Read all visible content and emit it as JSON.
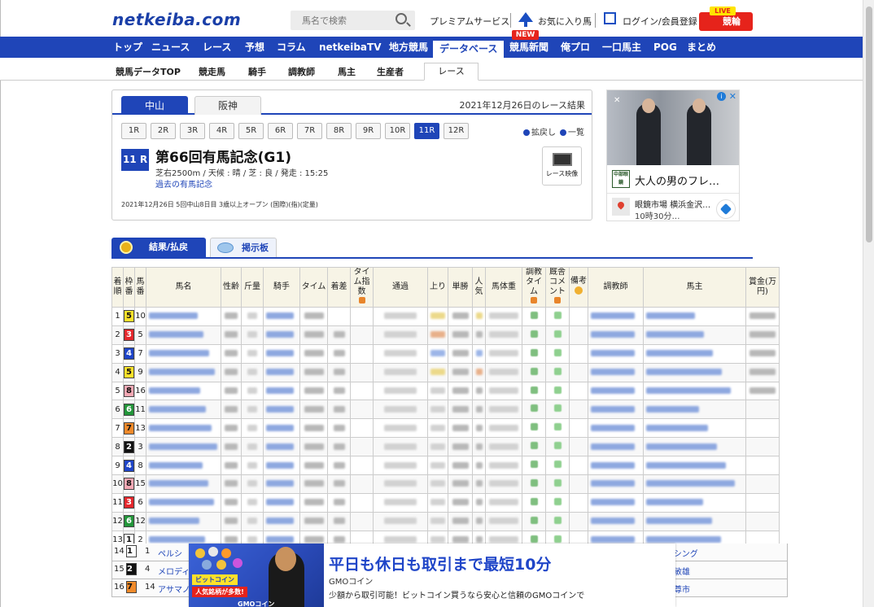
{
  "header": {
    "logo": "netkeiba.com",
    "search_placeholder": "馬名で検索",
    "premium": "プレミアムサービス",
    "favorites": "お気に入り馬",
    "login": "ログイン/会員登録",
    "live_tag": "LIVE",
    "live_label": "競輪"
  },
  "main_nav": {
    "new_tag": "NEW",
    "items": [
      "トップ",
      "ニュース",
      "レース",
      "予想",
      "コラム",
      "netkeibaTV",
      "地方競馬",
      "データベース",
      "競馬新聞",
      "俺プロ",
      "一口馬主",
      "POG",
      "まとめ"
    ]
  },
  "sub_nav": {
    "items": [
      "競馬データTOP",
      "競走馬",
      "騎手",
      "調教師",
      "馬主",
      "生産者",
      "レース"
    ]
  },
  "race": {
    "venues": [
      "中山",
      "阪神"
    ],
    "result_date": "2021年12月26日のレース結果",
    "rounds": [
      "1R",
      "2R",
      "3R",
      "4R",
      "5R",
      "6R",
      "7R",
      "8R",
      "9R",
      "10R",
      "11R",
      "12R"
    ],
    "expand": "拡戻し",
    "list": "一覧",
    "race_no": "11 R",
    "name": "第66回有馬記念(G1)",
    "detail": "芝右2500m / 天候 : 晴 / 芝 : 良 / 発走 : 15:25",
    "past": "過去の有馬記念",
    "sub": "2021年12月26日 5回中山8日目 3歳以上オープン (国際)(指)(定量)",
    "video": "レース映像"
  },
  "side_ad": {
    "logo": "中部眼鏡",
    "title": "大人の男のフレ…",
    "place": "眼鏡市場 横浜金沢…",
    "hours": "10時30分…"
  },
  "result_tabs": {
    "result": "結果/払戻",
    "board": "掲示板"
  },
  "table": {
    "headers": [
      "着順",
      "枠番",
      "馬番",
      "馬名",
      "性齢",
      "斤量",
      "騎手",
      "タイム",
      "着差",
      "タイム指数",
      "通過",
      "上り",
      "単勝",
      "人気",
      "馬体重",
      "調教タイム",
      "厩舎コメント",
      "備考",
      "調教師",
      "馬主",
      "賞金(万円)"
    ],
    "rows": [
      {
        "rank": "1",
        "frame": "5",
        "num": "10"
      },
      {
        "rank": "2",
        "frame": "3",
        "num": "5"
      },
      {
        "rank": "3",
        "frame": "4",
        "num": "7"
      },
      {
        "rank": "4",
        "frame": "5",
        "num": "9"
      },
      {
        "rank": "5",
        "frame": "8",
        "num": "16"
      },
      {
        "rank": "6",
        "frame": "6",
        "num": "11"
      },
      {
        "rank": "7",
        "frame": "7",
        "num": "13"
      },
      {
        "rank": "8",
        "frame": "2",
        "num": "3"
      },
      {
        "rank": "9",
        "frame": "4",
        "num": "8"
      },
      {
        "rank": "10",
        "frame": "8",
        "num": "15"
      },
      {
        "rank": "11",
        "frame": "3",
        "num": "6"
      },
      {
        "rank": "12",
        "frame": "6",
        "num": "12"
      },
      {
        "rank": "13",
        "frame": "1",
        "num": "2"
      }
    ],
    "lower_rows": [
      {
        "rank": "14",
        "frame": "1",
        "num": "1",
        "name": "ペルシ",
        "owner": "ーシング"
      },
      {
        "rank": "15",
        "frame": "2",
        "num": "4",
        "name": "メロディー",
        "owner": "敏雄"
      },
      {
        "rank": "16",
        "frame": "7",
        "num": "14",
        "name": "アサマノ",
        "owner": "尊市"
      }
    ]
  },
  "bottom_ad": {
    "tag1": "ビットコイン",
    "tag2": "人気銘柄が多数!",
    "logo": "GMOコイン",
    "headline": "平日も休日も取引まで最短10分",
    "brand": "GMOコイン",
    "desc": "少額から取引可能！ビットコイン買うなら安心と信頼のGMOコインで"
  }
}
